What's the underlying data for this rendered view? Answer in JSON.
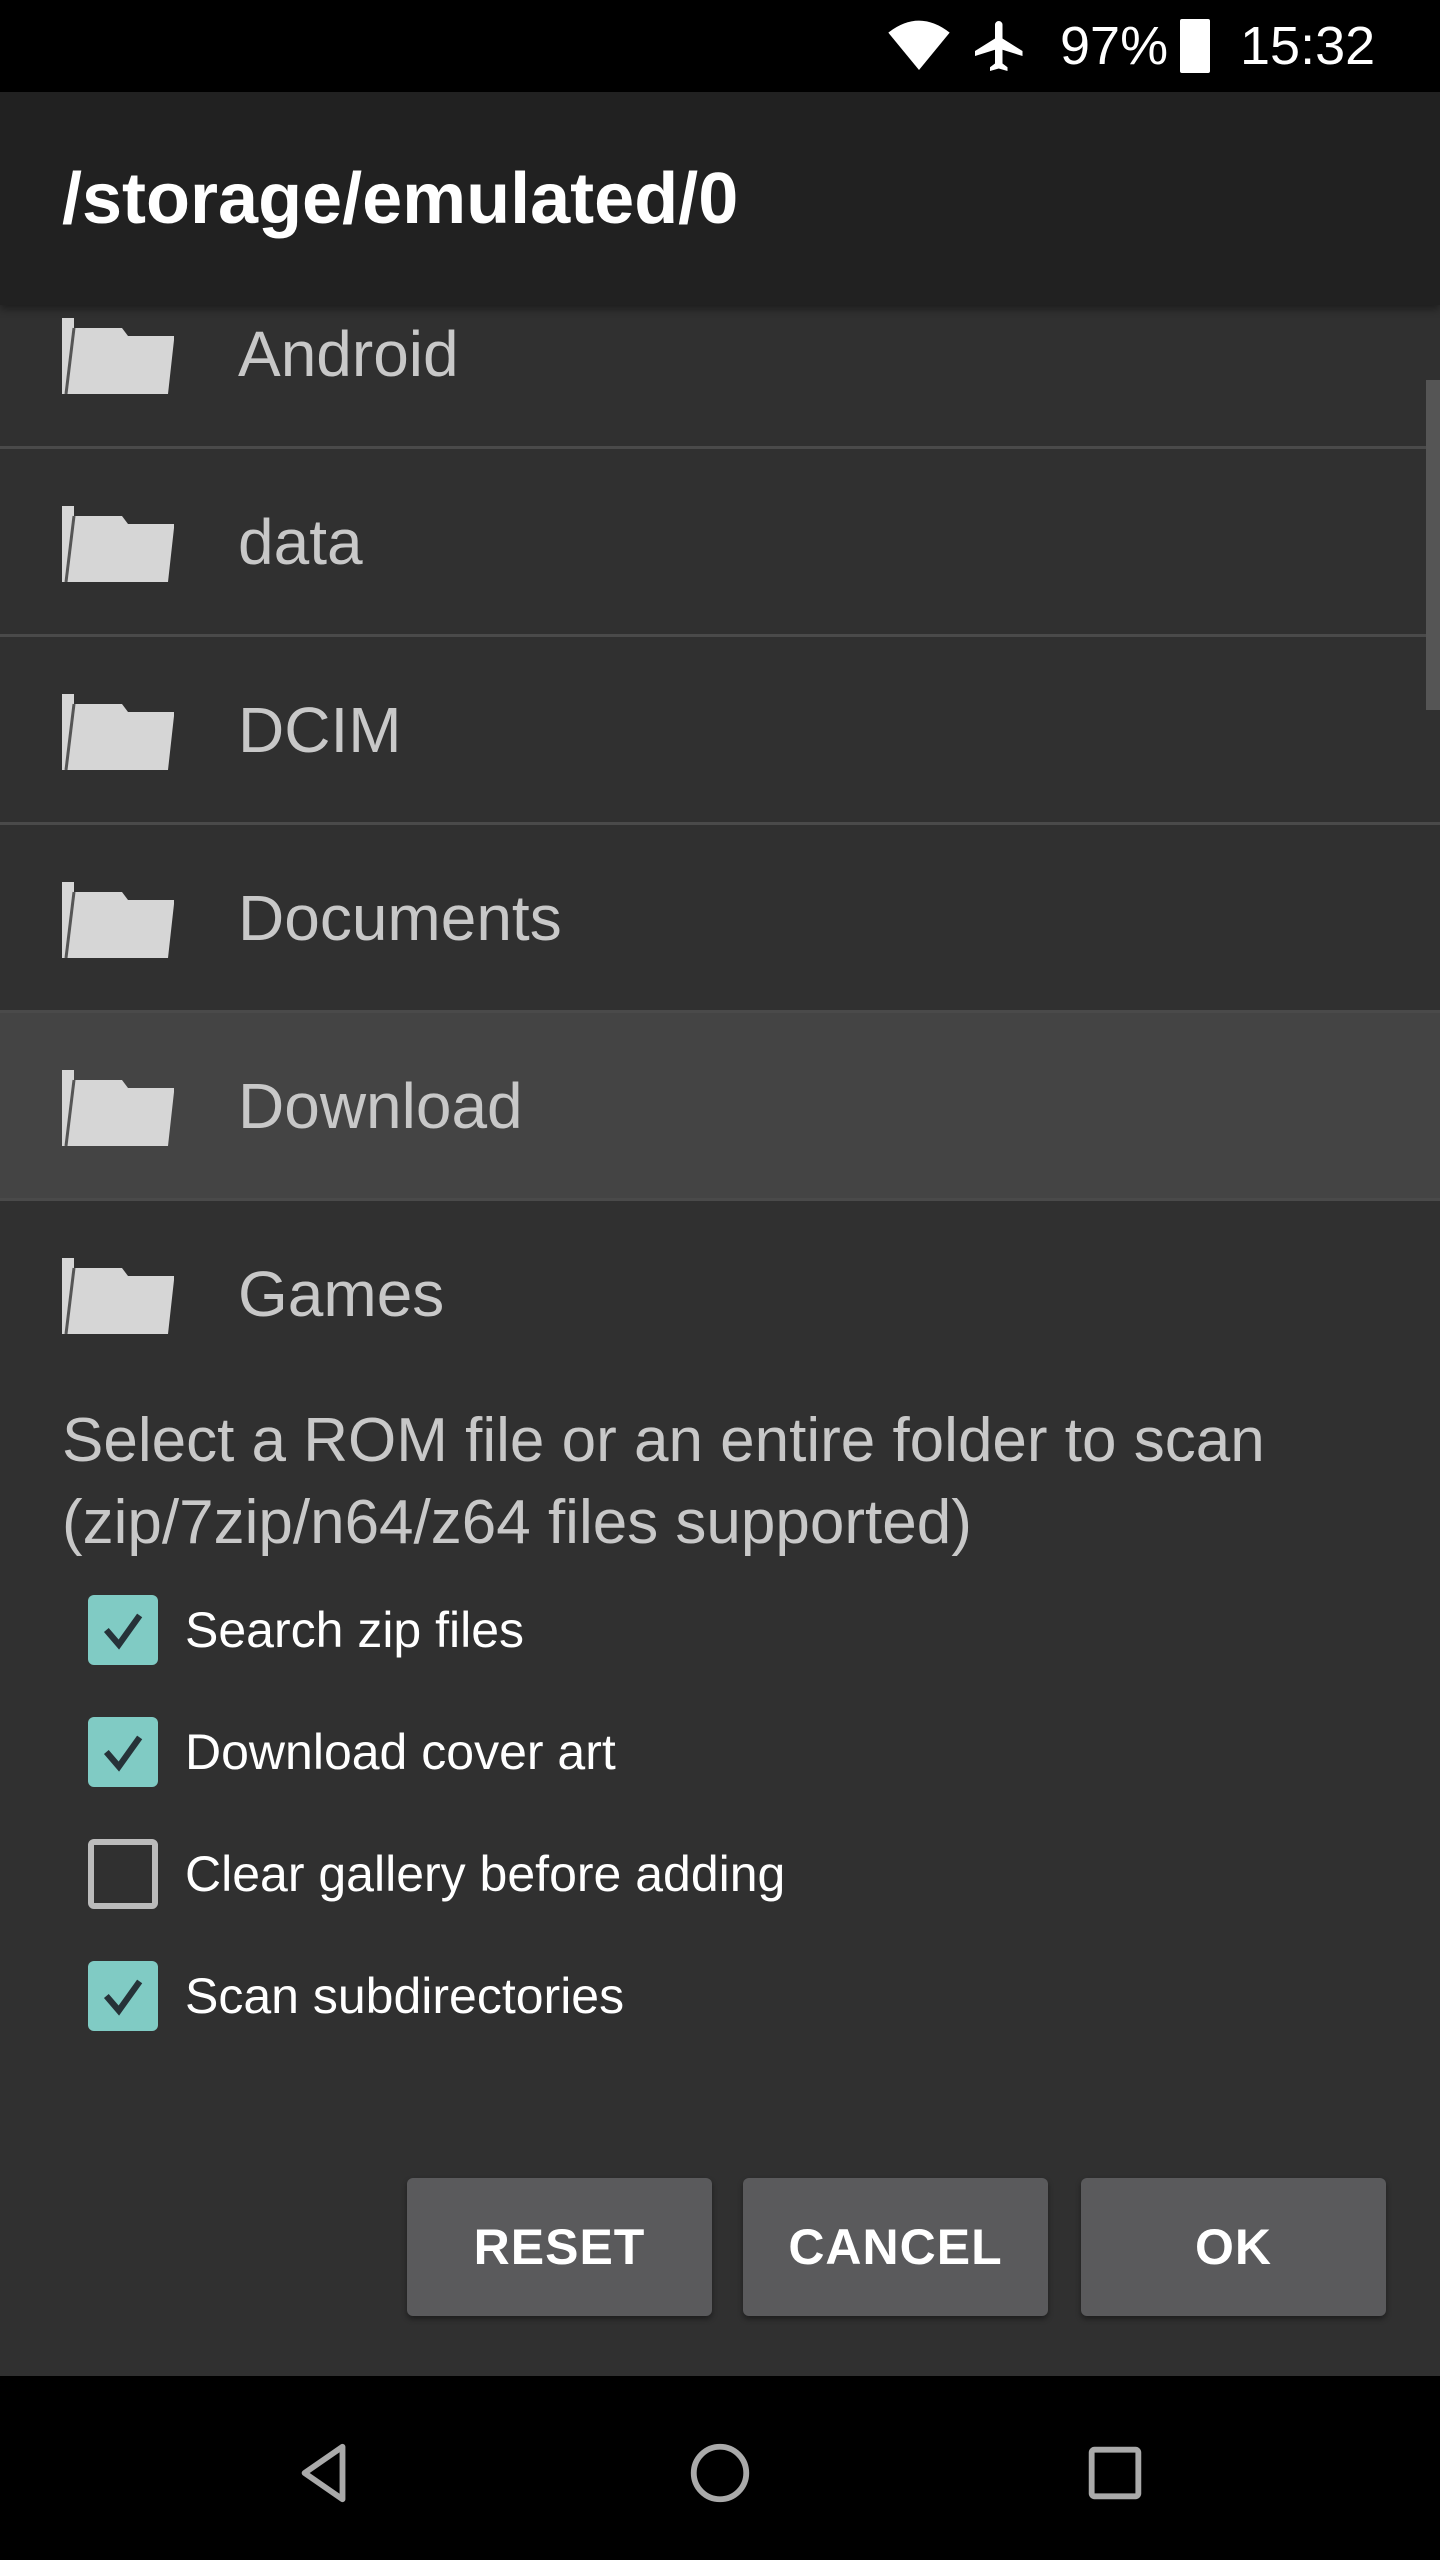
{
  "status_bar": {
    "battery": "97%",
    "time": "15:32",
    "icons": [
      "wifi-icon",
      "airplane-icon",
      "battery-icon"
    ]
  },
  "header": {
    "title": "/storage/emulated/0"
  },
  "folders": [
    {
      "label": "Android"
    },
    {
      "label": "data"
    },
    {
      "label": "DCIM"
    },
    {
      "label": "Documents"
    },
    {
      "label": "Download",
      "highlighted": true
    },
    {
      "label": "Games"
    }
  ],
  "message": "Select a ROM file or an entire folder to scan (zip/7zip/n64/z64 files supported)",
  "options": [
    {
      "label": "Search zip files",
      "checked": true
    },
    {
      "label": "Download cover art",
      "checked": true
    },
    {
      "label": "Clear gallery before adding",
      "checked": false
    },
    {
      "label": "Scan subdirectories",
      "checked": true
    }
  ],
  "buttons": {
    "reset": "RESET",
    "cancel": "CANCEL",
    "ok": "OK"
  },
  "colors": {
    "accent": "#80cbc4",
    "background": "#303030",
    "header": "#212121",
    "highlight": "#444444"
  },
  "nav": [
    "back-icon",
    "home-icon",
    "recents-icon"
  ]
}
